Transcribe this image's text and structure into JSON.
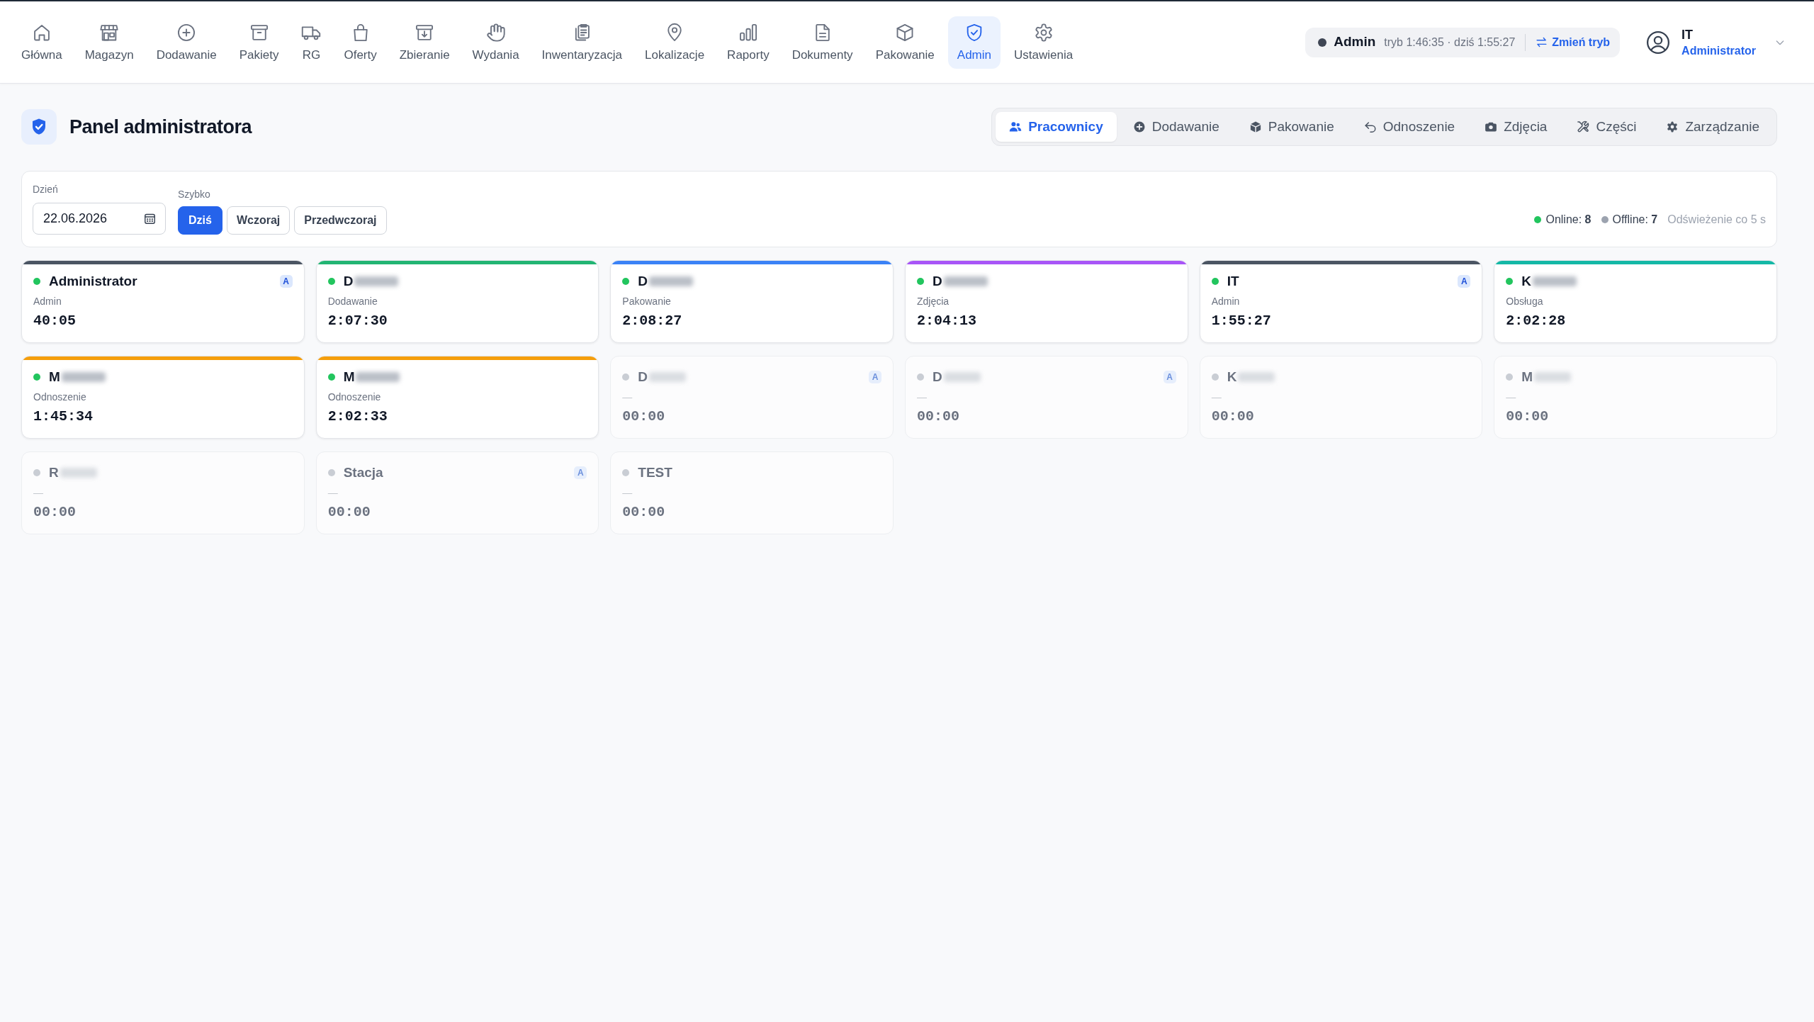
{
  "nav": {
    "items": [
      {
        "label": "Główna",
        "selected": false
      },
      {
        "label": "Magazyn",
        "selected": false
      },
      {
        "label": "Dodawanie",
        "selected": false
      },
      {
        "label": "Pakiety",
        "selected": false
      },
      {
        "label": "RG",
        "selected": false
      },
      {
        "label": "Oferty",
        "selected": false
      },
      {
        "label": "Zbieranie",
        "selected": false
      },
      {
        "label": "Wydania",
        "selected": false
      },
      {
        "label": "Inwentaryzacja",
        "selected": false
      },
      {
        "label": "Lokalizacje",
        "selected": false
      },
      {
        "label": "Raporty",
        "selected": false
      },
      {
        "label": "Dokumenty",
        "selected": false
      },
      {
        "label": "Pakowanie",
        "selected": false
      },
      {
        "label": "Admin",
        "selected": true
      },
      {
        "label": "Ustawienia",
        "selected": false
      }
    ]
  },
  "mode_indicator": {
    "mode": "Admin",
    "status": "tryb 1:46:35 · dziś 1:55:27",
    "switch_label": "Zmień tryb"
  },
  "user": {
    "name": "IT",
    "role": "Administrator"
  },
  "page": {
    "title": "Panel administratora",
    "tabs": [
      {
        "label": "Pracownicy",
        "selected": true
      },
      {
        "label": "Dodawanie",
        "selected": false
      },
      {
        "label": "Pakowanie",
        "selected": false
      },
      {
        "label": "Odnoszenie",
        "selected": false
      },
      {
        "label": "Zdjęcia",
        "selected": false
      },
      {
        "label": "Części",
        "selected": false
      },
      {
        "label": "Zarządzanie",
        "selected": false
      }
    ]
  },
  "filter": {
    "day_label": "Dzień",
    "date": "22.06.2026",
    "quick_label": "Szybko",
    "quick_buttons": [
      {
        "label": "Dziś",
        "selected": true
      },
      {
        "label": "Wczoraj",
        "selected": false
      },
      {
        "label": "Przedwczoraj",
        "selected": false
      }
    ],
    "online": "Online: **8**",
    "offline": "Offline: **7**",
    "refresh": "Odświeżenie co 5 s"
  },
  "workers": [
    {
      "name": "Administrator",
      "redacted": false,
      "online": true,
      "role": "Admin",
      "time": "40:05",
      "badge": "A",
      "color": "#4b5563"
    },
    {
      "name": "D",
      "redacted": true,
      "online": true,
      "role": "Dodawanie",
      "time": "2:07:30",
      "color": "#22b573"
    },
    {
      "name": "D",
      "redacted": true,
      "online": true,
      "role": "Pakowanie",
      "time": "2:08:27",
      "color": "#3b82f6"
    },
    {
      "name": "D",
      "redacted": true,
      "online": true,
      "role": "Zdjęcia",
      "time": "2:04:13",
      "color": "#a855f7"
    },
    {
      "name": "IT",
      "redacted": false,
      "online": true,
      "role": "Admin",
      "time": "1:55:27",
      "badge": "A",
      "color": "#4b5563"
    },
    {
      "name": "K",
      "redacted": true,
      "online": true,
      "role": "Obsługa",
      "time": "2:02:28",
      "color": "#14b8a6"
    },
    {
      "name": "M",
      "redacted": true,
      "online": true,
      "role": "Odnoszenie",
      "time": "1:45:34",
      "color": "#f59e0b"
    },
    {
      "name": "M",
      "redacted": true,
      "online": true,
      "role": "Odnoszenie",
      "time": "2:02:33",
      "color": "#f59e0b"
    },
    {
      "name": "D",
      "redacted": true,
      "online": false,
      "role": "—",
      "time": "00:00",
      "badge": "A"
    },
    {
      "name": "D",
      "redacted": true,
      "online": false,
      "role": "—",
      "time": "00:00",
      "badge": "A"
    },
    {
      "name": "K",
      "redacted": true,
      "online": false,
      "role": "—",
      "time": "00:00"
    },
    {
      "name": "M",
      "redacted": true,
      "online": false,
      "role": "—",
      "time": "00:00"
    },
    {
      "name": "R",
      "redacted": true,
      "online": false,
      "role": "—",
      "time": "00:00"
    },
    {
      "name": "Stacja",
      "redacted": false,
      "online": false,
      "role": "—",
      "time": "00:00",
      "badge": "A"
    },
    {
      "name": "TEST",
      "redacted": false,
      "online": false,
      "role": "—",
      "time": "00:00"
    }
  ]
}
